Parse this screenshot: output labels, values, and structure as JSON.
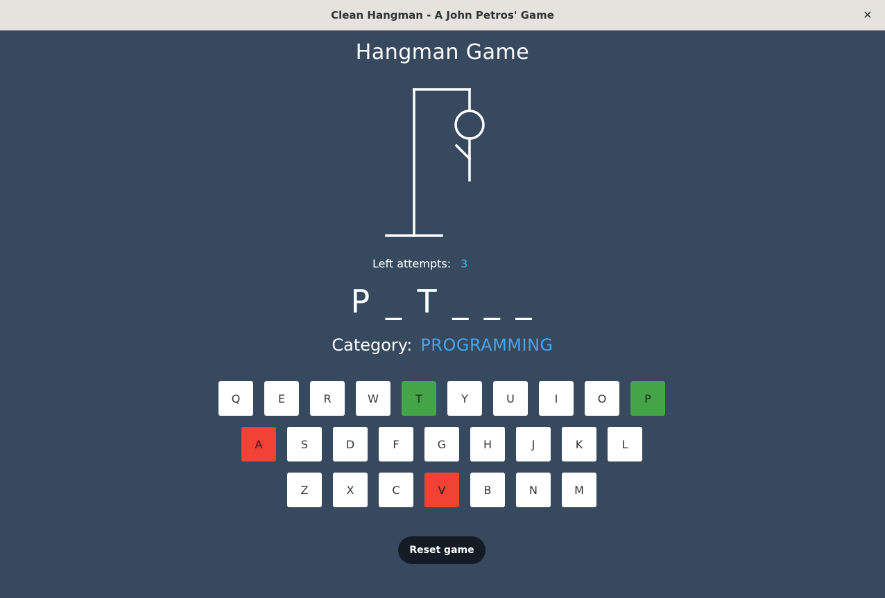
{
  "window": {
    "title": "Clean Hangman - A John Petros' Game",
    "close_icon": "✕"
  },
  "game": {
    "title": "Hangman Game",
    "attempts_label": "Left attempts:",
    "attempts_left": "3",
    "word_display": "P _ T _ _ _",
    "category_label": "Category:",
    "category": "PROGRAMMING"
  },
  "keyboard": {
    "rows": [
      [
        {
          "letter": "Q",
          "state": "unused"
        },
        {
          "letter": "E",
          "state": "unused"
        },
        {
          "letter": "R",
          "state": "unused"
        },
        {
          "letter": "W",
          "state": "unused"
        },
        {
          "letter": "T",
          "state": "correct"
        },
        {
          "letter": "Y",
          "state": "unused"
        },
        {
          "letter": "U",
          "state": "unused"
        },
        {
          "letter": "I",
          "state": "unused"
        },
        {
          "letter": "O",
          "state": "unused"
        },
        {
          "letter": "P",
          "state": "correct"
        }
      ],
      [
        {
          "letter": "A",
          "state": "wrong"
        },
        {
          "letter": "S",
          "state": "unused"
        },
        {
          "letter": "D",
          "state": "unused"
        },
        {
          "letter": "F",
          "state": "unused"
        },
        {
          "letter": "G",
          "state": "unused"
        },
        {
          "letter": "H",
          "state": "unused"
        },
        {
          "letter": "J",
          "state": "unused"
        },
        {
          "letter": "K",
          "state": "unused"
        },
        {
          "letter": "L",
          "state": "unused"
        }
      ],
      [
        {
          "letter": "Z",
          "state": "unused"
        },
        {
          "letter": "X",
          "state": "unused"
        },
        {
          "letter": "C",
          "state": "unused"
        },
        {
          "letter": "V",
          "state": "wrong"
        },
        {
          "letter": "B",
          "state": "unused"
        },
        {
          "letter": "N",
          "state": "unused"
        },
        {
          "letter": "M",
          "state": "unused"
        }
      ]
    ]
  },
  "reset_label": "Reset game",
  "colors": {
    "background": "#36495e",
    "correct": "#43a548",
    "wrong": "#f24236",
    "accent": "#4aa3e8",
    "attempts": "#36c5e0"
  }
}
